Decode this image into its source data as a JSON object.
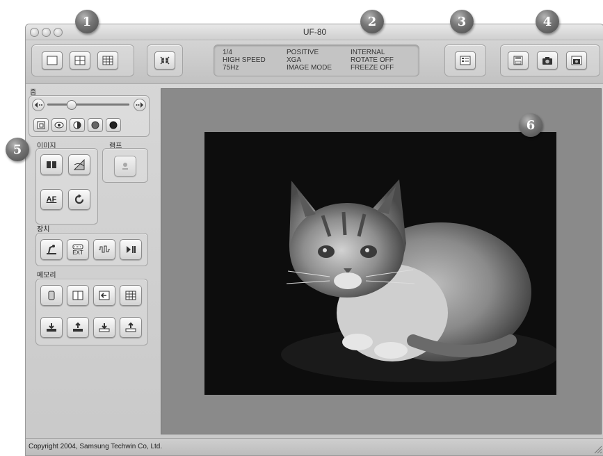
{
  "window": {
    "title": "UF-80"
  },
  "status": {
    "col1": [
      "1/4",
      "HIGH SPEED",
      "75Hz"
    ],
    "col2": [
      "POSITIVE",
      "XGA",
      "IMAGE MODE"
    ],
    "col3": [
      "INTERNAL",
      "ROTATE OFF",
      "FREEZE OFF"
    ]
  },
  "sidebar": {
    "zoom_label": "줌",
    "image_label": "이미지",
    "lamp_label": "램프",
    "device_label": "장치",
    "memory_label": "메모리",
    "af_label": "AF",
    "ext_label": "EXT"
  },
  "callouts": [
    "1",
    "2",
    "3",
    "4",
    "5",
    "6"
  ],
  "footer": {
    "copyright": "Copyright 2004, Samsung Techwin Co, Ltd."
  }
}
